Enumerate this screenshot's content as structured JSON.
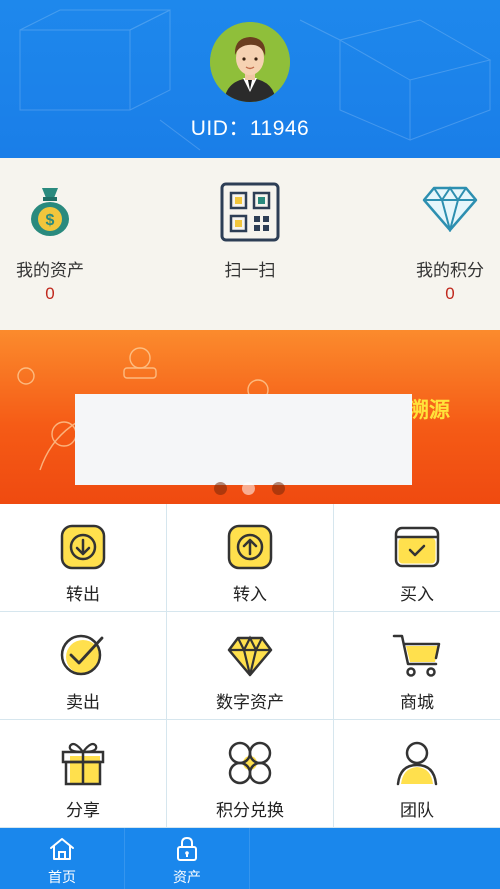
{
  "header": {
    "uid": "UID：11946",
    "avatar_icon": "user-avatar"
  },
  "quick": [
    {
      "label": "我的资产",
      "value": "0",
      "icon": "money-bag-icon"
    },
    {
      "label": "扫一扫",
      "value": "",
      "icon": "qr-code-icon"
    },
    {
      "label": "我的积分",
      "value": "0",
      "icon": "diamond-icon"
    }
  ],
  "banner": {
    "visible_text": "溯源",
    "dots": 3
  },
  "grid": [
    {
      "label": "转出",
      "icon": "arrow-down-icon"
    },
    {
      "label": "转入",
      "icon": "arrow-up-icon"
    },
    {
      "label": "买入",
      "icon": "calendar-check-icon"
    },
    {
      "label": "卖出",
      "icon": "check-circle-icon"
    },
    {
      "label": "数字资产",
      "icon": "gem-icon"
    },
    {
      "label": "商城",
      "icon": "cart-icon"
    },
    {
      "label": "分享",
      "icon": "gift-icon"
    },
    {
      "label": "积分兑换",
      "icon": "clover-icon"
    },
    {
      "label": "团队",
      "icon": "team-user-icon"
    }
  ],
  "nav": [
    {
      "label": "首页",
      "icon": "home-icon"
    },
    {
      "label": "资产",
      "icon": "lock-icon"
    }
  ],
  "colors": {
    "header_blue": "#1e88ec",
    "accent_yellow": "#ffe04d",
    "value_red": "#c0281d",
    "banner_orange": "#f55b16"
  }
}
